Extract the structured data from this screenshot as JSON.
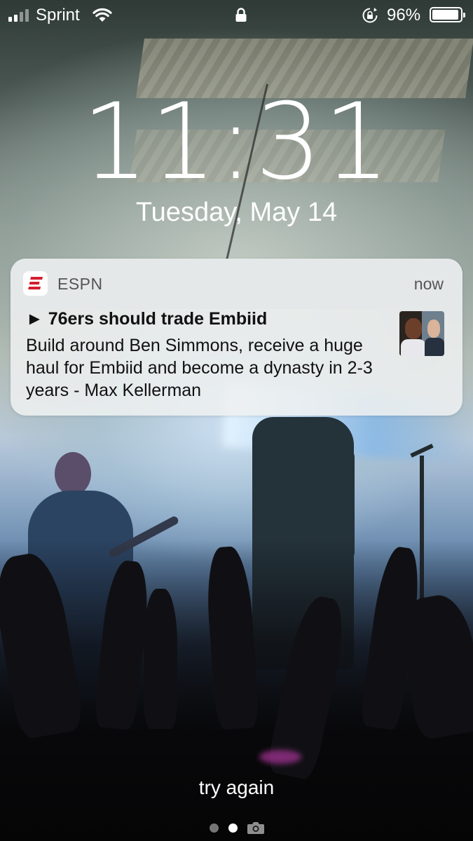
{
  "status_bar": {
    "carrier": "Sprint",
    "signal_bars_filled": 2,
    "signal_bars_total": 4,
    "battery_percent": "96%",
    "battery_level": 0.96,
    "icons": [
      "signal-icon",
      "wifi-icon",
      "lock-icon",
      "rotation-lock-icon",
      "battery-icon"
    ]
  },
  "lock_screen": {
    "time": "11:31",
    "date": "Tuesday, May 14"
  },
  "notification": {
    "app_name": "ESPN",
    "time": "now",
    "title": "► 76ers should trade Embiid",
    "body": "Build around Ben Simmons, receive a huge haul for Embiid and become a dynasty in 2-3 years - Max Kellerman",
    "app_icon": "espn-logo-icon",
    "accent_color": "#d41e2f"
  },
  "bottom": {
    "prompt": "try again",
    "page_count": 2,
    "active_page": 1,
    "camera_icon": "camera-icon"
  }
}
